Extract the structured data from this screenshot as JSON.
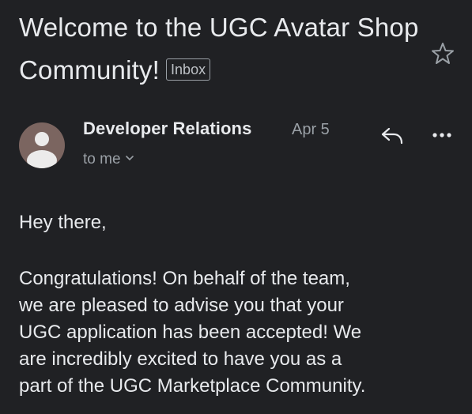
{
  "email": {
    "subject": "Welcome to the UGC Avatar Shop Community!",
    "label": "Inbox",
    "sender": "Developer Relations",
    "date": "Apr 5",
    "recipient": "to me",
    "greeting": "Hey there,",
    "body": "Congratulations! On behalf of the team,\nwe are pleased to advise you that your\nUGC application has been accepted! We\nare incredibly excited to have you as a\npart of the UGC Marketplace Community."
  },
  "icons": {
    "star": "star-icon",
    "reply": "reply-icon",
    "more": "more-icon",
    "chevron": "chevron-down-icon",
    "avatar": "default-avatar"
  },
  "colors": {
    "background": "#202124",
    "text": "#e8eaed",
    "secondary_text": "#9aa0a6",
    "avatar_bg": "#7b6560",
    "avatar_fg": "#ecebeb"
  }
}
